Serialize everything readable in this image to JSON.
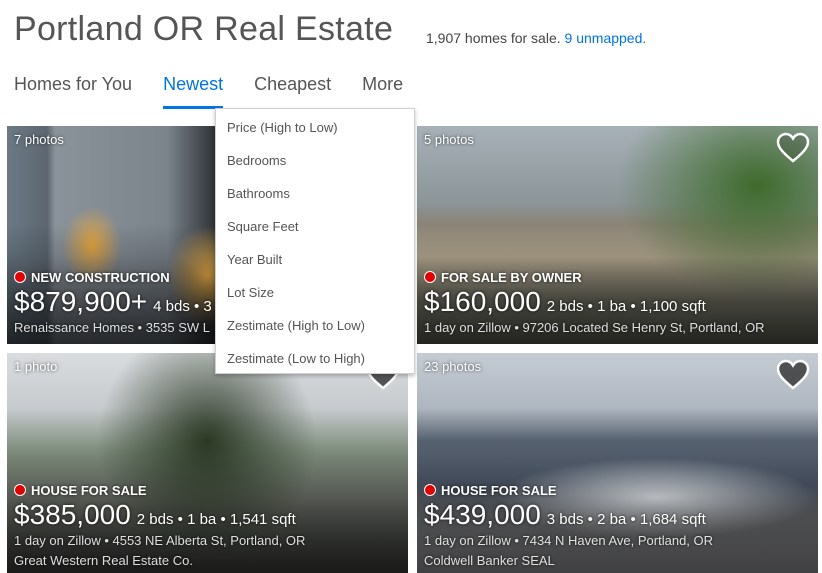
{
  "header": {
    "title": "Portland OR Real Estate",
    "count_text": "1,907 homes for sale.",
    "unmapped_link": "9 unmapped."
  },
  "tabs": [
    {
      "label": "Homes for You",
      "active": false
    },
    {
      "label": "Newest",
      "active": true
    },
    {
      "label": "Cheapest",
      "active": false
    },
    {
      "label": "More",
      "active": false
    }
  ],
  "sort_menu": {
    "items": [
      "Price (High to Low)",
      "Bedrooms",
      "Bathrooms",
      "Square Feet",
      "Year Built",
      "Lot Size",
      "Zestimate (High to Low)",
      "Zestimate (Low to High)"
    ]
  },
  "listings": [
    {
      "photos": "7 photos",
      "status": "NEW CONSTRUCTION",
      "price": "$879,900+",
      "facts": "4 bds • 3",
      "meta": "Renaissance Homes  •  3535 SW L",
      "broker": "",
      "saved": false,
      "status_color": "#e00000"
    },
    {
      "photos": "5 photos",
      "status": "FOR SALE BY OWNER",
      "price": "$160,000",
      "facts": "2 bds • 1 ba • 1,100 sqft",
      "meta": "1 day on Zillow  •  97206 Located Se Henry St, Portland, OR",
      "broker": "",
      "saved": false,
      "status_color": "#e00000"
    },
    {
      "photos": "1 photo",
      "status": "HOUSE FOR SALE",
      "price": "$385,000",
      "facts": "2 bds • 1 ba • 1,541 sqft",
      "meta": "1 day on Zillow  •  4553 NE Alberta St, Portland, OR",
      "broker": "Great Western Real Estate Co.",
      "saved": false,
      "status_color": "#e00000"
    },
    {
      "photos": "23 photos",
      "status": "HOUSE FOR SALE",
      "price": "$439,000",
      "facts": "3 bds • 2 ba • 1,684 sqft",
      "meta": "1 day on Zillow  •  7434 N Haven Ave, Portland, OR",
      "broker": "Coldwell Banker SEAL",
      "saved": false,
      "status_color": "#e00000"
    }
  ],
  "colors": {
    "accent": "#0074e4",
    "status_dot": "#e00000"
  }
}
